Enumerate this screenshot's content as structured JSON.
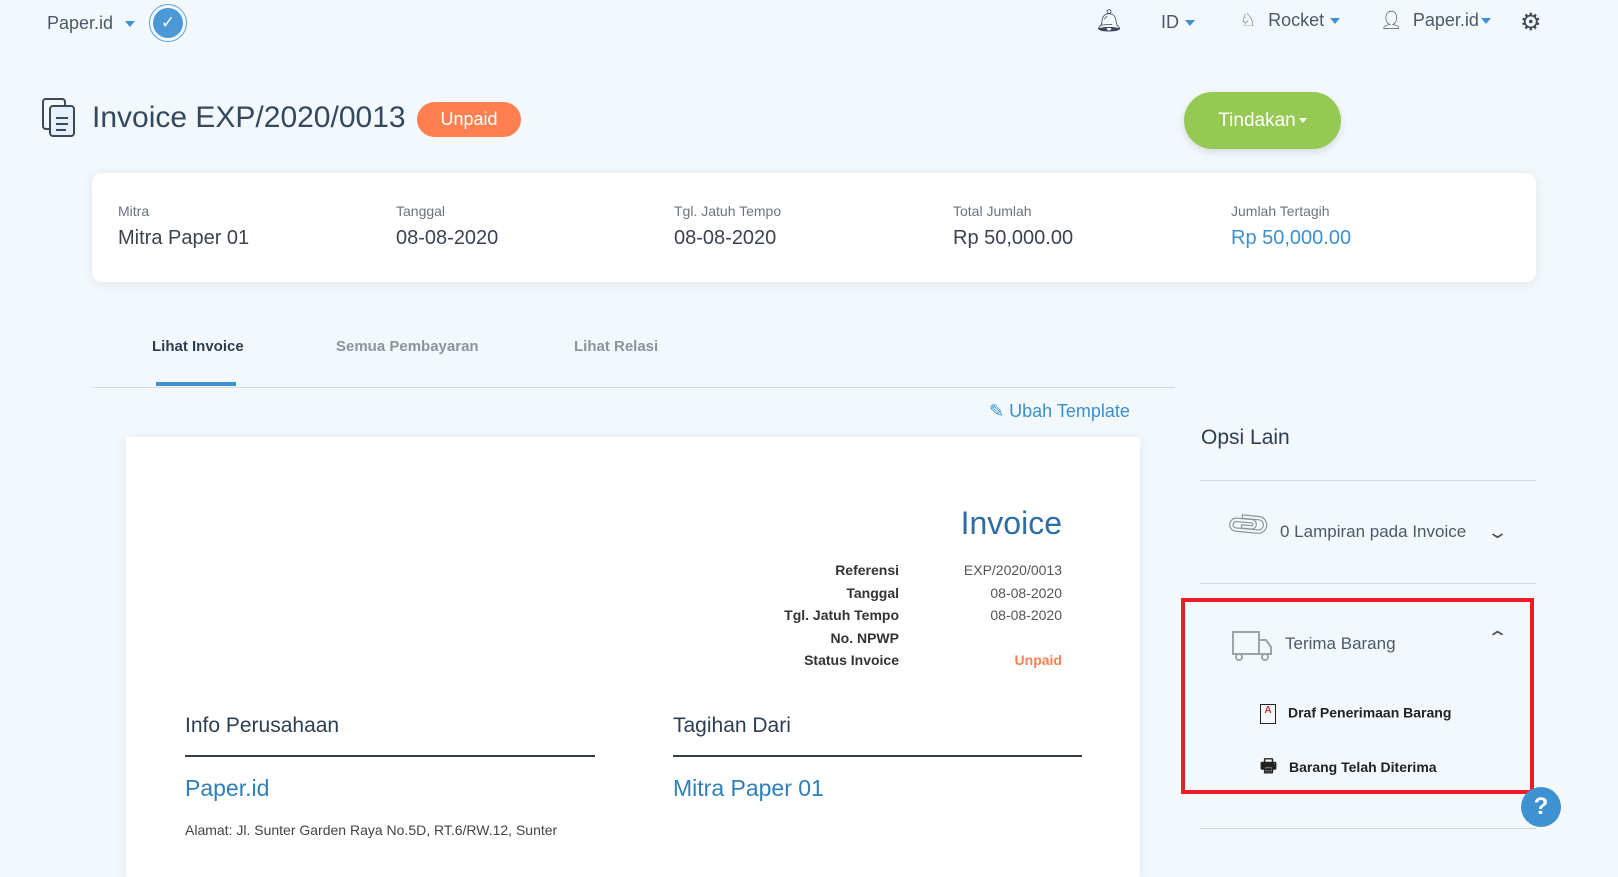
{
  "topbar": {
    "brand": "Paper.id",
    "lang": "ID",
    "plan": "Rocket",
    "user": "Paper.id"
  },
  "header": {
    "title": "Invoice EXP/2020/0013",
    "status": "Unpaid",
    "action_label": "Tindakan"
  },
  "summary": [
    {
      "label": "Mitra",
      "value": "Mitra Paper 01"
    },
    {
      "label": "Tanggal",
      "value": "08-08-2020"
    },
    {
      "label": "Tgl. Jatuh Tempo",
      "value": "08-08-2020"
    },
    {
      "label": "Total Jumlah",
      "value": "Rp 50,000.00"
    },
    {
      "label": "Jumlah Tertagih",
      "value": "Rp 50,000.00"
    }
  ],
  "tabs": [
    "Lihat Invoice",
    "Semua Pembayaran",
    "Lihat Relasi"
  ],
  "edit_template": "Ubah Template",
  "invoice": {
    "heading": "Invoice",
    "meta_labels": [
      "Referensi",
      "Tanggal",
      "Tgl. Jatuh Tempo",
      "No. NPWP",
      "Status Invoice"
    ],
    "meta_values": [
      "EXP/2020/0013",
      "08-08-2020",
      "08-08-2020",
      "",
      "Unpaid"
    ],
    "company_title": "Info Perusahaan",
    "company_name": "Paper.id",
    "company_address": "Alamat: Jl. Sunter Garden Raya No.5D, RT.6/RW.12, Sunter",
    "billing_title": "Tagihan Dari",
    "billing_name": "Mitra Paper 01"
  },
  "sidebar": {
    "title": "Opsi Lain",
    "attachments": "0 Lampiran pada Invoice",
    "receive": "Terima Barang",
    "sub_items": [
      "Draf Penerimaan Barang",
      "Barang Telah Diterima"
    ]
  },
  "help": "?"
}
